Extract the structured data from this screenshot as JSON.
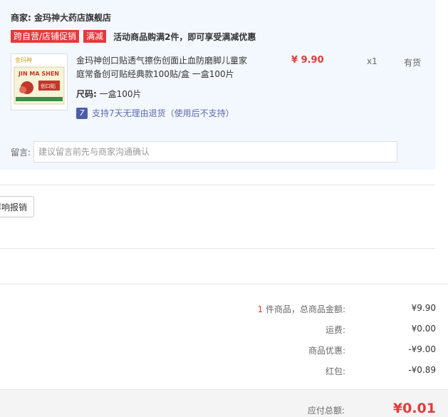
{
  "shop": {
    "label": "商家: 金玛神大药店旗舰店",
    "tags": [
      "跨自营/店铺促销",
      "满减"
    ],
    "promo_text": "活动商品购满2件，即可享受满减优惠"
  },
  "item": {
    "thumb_brand": "金玛神",
    "thumb_title": "JIN MA SHEN",
    "thumb_sub": "创口贴",
    "name": "金玛神创口贴透气擦伤创面止血防磨脚儿童家庭常备创可贴经典款100贴/盒 一盒100片",
    "price": "¥ 9.90",
    "qty": "x1",
    "stock": "有货",
    "size_label": "尺码:",
    "size_value": "一盒100片",
    "return_icon": "7",
    "return_text": "支持7天无理由退货（使用后不支持）"
  },
  "note": {
    "label": "留言:",
    "placeholder": "建议留言前先与商家沟通确认"
  },
  "invoice": {
    "button_label": "详响报销"
  },
  "summary": {
    "count": "1",
    "goods_label": " 件商品，总商品金额:",
    "goods_value": "¥9.90",
    "freight_label": "运费:",
    "freight_value": "¥0.00",
    "discount_label": "商品优惠:",
    "discount_value": "-¥9.00",
    "redpacket_label": "红包:",
    "redpacket_value": "-¥0.89"
  },
  "total": {
    "label": "应付总额:",
    "value": "¥0.01"
  },
  "colors": {
    "accent": "#e4393c",
    "panel": "#f3f8fe",
    "link": "#5e69ad"
  }
}
